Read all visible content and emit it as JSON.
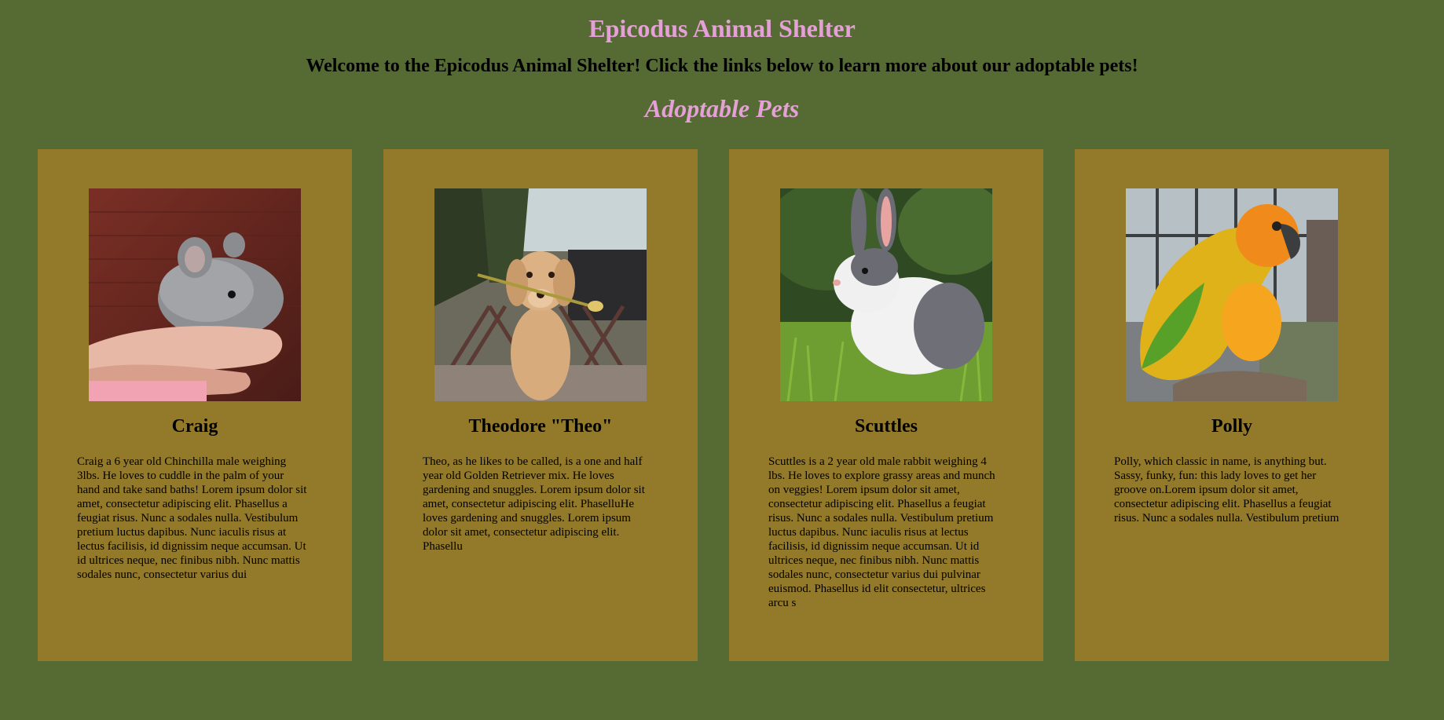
{
  "header": {
    "title": "Epicodus Animal Shelter",
    "welcome": "Welcome to the Epicodus Animal Shelter! Click the links below to learn more about our adoptable pets!",
    "section_title": "Adoptable Pets"
  },
  "colors": {
    "page_bg": "#556b33",
    "card_bg": "#937a2a",
    "title_pink": "#e6a0d8"
  },
  "pets": [
    {
      "name": "Craig",
      "photo": "chinchilla-photo",
      "description": "Craig a 6 year old Chinchilla male weighing 3lbs. He loves to cuddle in the palm of your hand and take sand baths! Lorem ipsum dolor sit amet, consectetur adipiscing elit. Phasellus a feugiat risus. Nunc a sodales nulla. Vestibulum pretium luctus dapibus. Nunc iaculis risus at lectus facilisis, id dignissim neque accumsan. Ut id ultrices neque, nec finibus nibh. Nunc mattis sodales nunc, consectetur varius dui"
    },
    {
      "name": "Theodore \"Theo\"",
      "photo": "golden-retriever-photo",
      "description": "Theo, as he likes to be called, is a one and half year old Golden Retriever mix. He loves gardening and snuggles. Lorem ipsum dolor sit amet, consectetur adipiscing elit. PhaselluHe loves gardening and snuggles. Lorem ipsum dolor sit amet, consectetur adipiscing elit. Phasellu"
    },
    {
      "name": "Scuttles",
      "photo": "rabbit-photo",
      "description": "Scuttles is a 2 year old male rabbit weighing 4 lbs. He loves to explore grassy areas and munch on veggies! Lorem ipsum dolor sit amet, consectetur adipiscing elit. Phasellus a feugiat risus. Nunc a sodales nulla. Vestibulum pretium luctus dapibus. Nunc iaculis risus at lectus facilisis, id dignissim neque accumsan. Ut id ultrices neque, nec finibus nibh. Nunc mattis sodales nunc, consectetur varius dui pulvinar euismod. Phasellus id elit consectetur, ultrices arcu s"
    },
    {
      "name": "Polly",
      "photo": "parrot-photo",
      "description": "Polly, which classic in name, is anything but. Sassy, funky, fun: this lady loves to get her groove on.Lorem ipsum dolor sit amet, consectetur adipiscing elit. Phasellus a feugiat risus. Nunc a sodales nulla. Vestibulum pretium"
    }
  ]
}
